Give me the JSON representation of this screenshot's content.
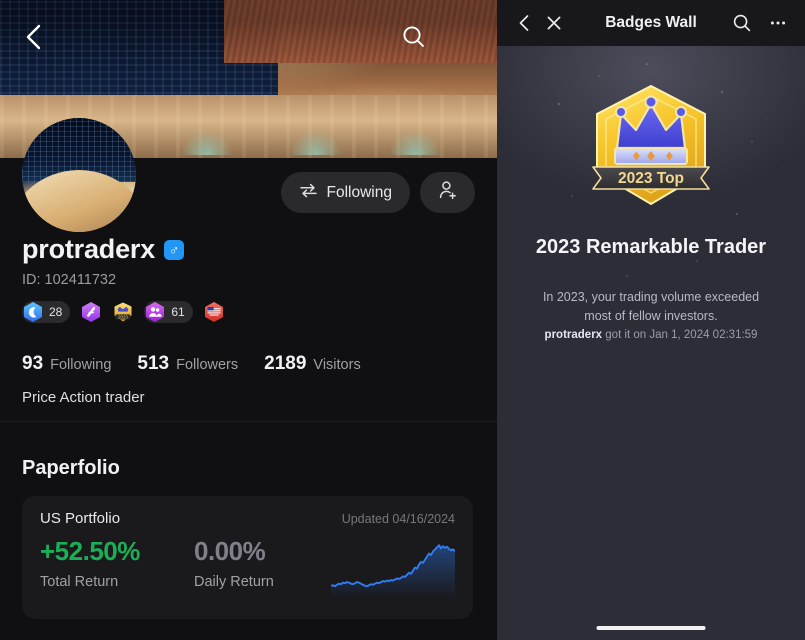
{
  "colors": {
    "profile_bg": "#101012",
    "badge_panel_bg": "#2d2d38",
    "header_bg": "#18181c",
    "card_bg": "#1a1a1d",
    "accent_green": "#1cae56",
    "accent_blue": "#2f7cf6",
    "chip_bg": "#2a2a2d",
    "gold": "#f5c93a"
  },
  "profile": {
    "cover": {
      "back_icon": "chevron-left-icon",
      "search_icon": "search-icon",
      "image_alt": "night-cityscape-promenade"
    },
    "avatar_alt": "night-city-avatar",
    "actions": {
      "following_label": "Following",
      "following_icon": "exchange-arrows-icon",
      "add_user_icon": "add-user-icon"
    },
    "username": "protraderx",
    "gender_icon": "male-symbol",
    "gender_glyph": "♂",
    "id_label": "ID: 102411732",
    "badges": [
      {
        "name": "moon-badge",
        "icon": "crescent-moon-icon",
        "count": "28",
        "color": "#2f7cf6"
      },
      {
        "name": "shield-badge",
        "icon": "lightning-shield-icon",
        "count": "",
        "color": "#a855f7"
      },
      {
        "name": "year-badge",
        "icon": "crown-2023-icon",
        "count": "",
        "color": "#e0b43a",
        "year": "2023"
      },
      {
        "name": "followers-badge",
        "icon": "people-icon",
        "count": "61",
        "color": "#b23cf0"
      },
      {
        "name": "flag-badge",
        "icon": "us-flag-icon",
        "count": "",
        "color": "#e2443a"
      }
    ],
    "stats": [
      {
        "num": "93",
        "label": "Following"
      },
      {
        "num": "513",
        "label": "Followers"
      },
      {
        "num": "2189",
        "label": "Visitors"
      }
    ],
    "bio": "Price Action trader",
    "paperfolio": {
      "section_title": "Paperfolio",
      "portfolio_name": "US Portfolio",
      "updated": "Updated 04/16/2024",
      "total_return_value": "+52.50%",
      "total_return_label": "Total Return",
      "daily_return_value": "0.00%",
      "daily_return_label": "Daily Return"
    }
  },
  "badge_wall": {
    "header": {
      "back_icon": "chevron-left-icon",
      "close_icon": "close-icon",
      "title": "Badges Wall",
      "search_icon": "search-icon",
      "more_icon": "more-horizontal-icon"
    },
    "hero": {
      "badge_icon": "crown-shield-badge",
      "ribbon_text": "2023 Top"
    },
    "name": "2023 Remarkable Trader",
    "description": "In 2023, your trading volume exceeded most of fellow investors.",
    "meta_user": "protraderx",
    "meta_rest": " got it on Jan 1, 2024 02:31:59"
  },
  "chart_data": {
    "type": "line",
    "title": "US Portfolio total return sparkline",
    "xlabel": "",
    "ylabel": "",
    "grid": false,
    "legend": false,
    "series": [
      {
        "name": "Total Return",
        "color": "#2f7cf6",
        "values": [
          12,
          13,
          11,
          14,
          16,
          15,
          18,
          17,
          19,
          18,
          16,
          15,
          17,
          19,
          18,
          16,
          14,
          12,
          11,
          13,
          15,
          14,
          16,
          18,
          17,
          19,
          21,
          20,
          22,
          21,
          23,
          22,
          24,
          26,
          25,
          27,
          30,
          29,
          33,
          37,
          35,
          41,
          47,
          45,
          53,
          58,
          56,
          62,
          68,
          74,
          71,
          78,
          82,
          86,
          90,
          84,
          88,
          85,
          87,
          83,
          80,
          82,
          79
        ]
      }
    ],
    "ylim": [
      0,
      100
    ]
  }
}
